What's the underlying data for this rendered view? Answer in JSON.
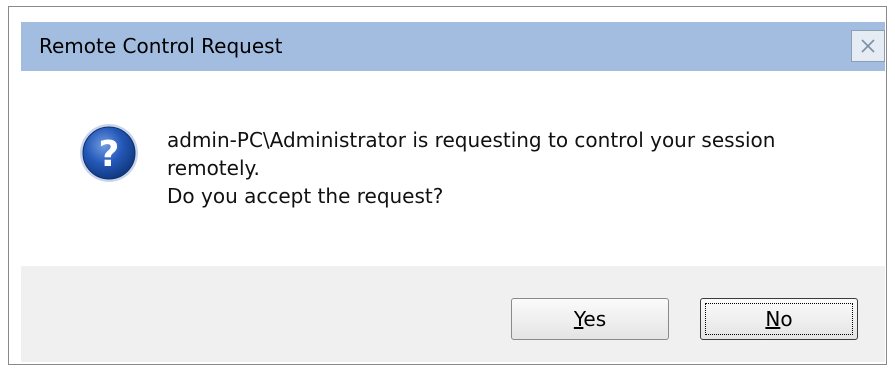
{
  "dialog": {
    "title": "Remote Control Request",
    "close_label": "Close",
    "message_line1": " admin-PC\\Administrator is requesting to control your session",
    "message_line2": "remotely.",
    "message_line3": "Do you accept the request?"
  },
  "buttons": {
    "yes_mnemonic": "Y",
    "yes_rest": "es",
    "no_mnemonic": "N",
    "no_rest": "o"
  },
  "icons": {
    "question": "question-icon",
    "close": "close-icon"
  },
  "colors": {
    "titlebar": "#a3bde0",
    "footer": "#f0f0f0",
    "icon_blue": "#1c4fa8"
  }
}
